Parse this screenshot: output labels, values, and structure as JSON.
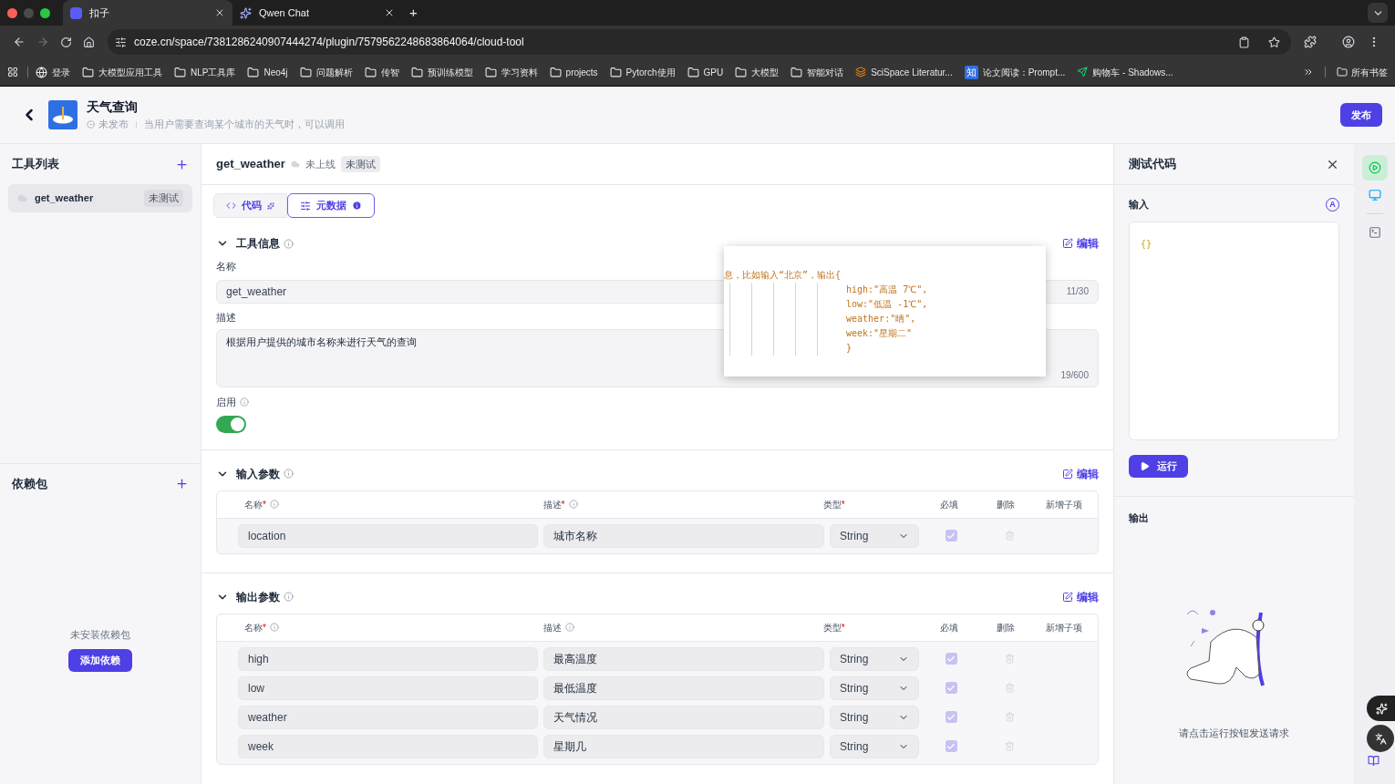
{
  "browser": {
    "tabs": [
      {
        "title": "扣子",
        "selected": true
      },
      {
        "title": "Qwen Chat",
        "selected": false
      }
    ],
    "new_tab": "+",
    "url": "coze.cn/space/7381286240907444274/plugin/7579562248683864064/cloud-tool",
    "bookmarks": [
      {
        "kind": "globe",
        "label": "登录"
      },
      {
        "kind": "folder",
        "label": "大模型应用工具"
      },
      {
        "kind": "folder",
        "label": "NLP工具库"
      },
      {
        "kind": "folder",
        "label": "Neo4j"
      },
      {
        "kind": "folder",
        "label": "问题解析"
      },
      {
        "kind": "folder",
        "label": "传智"
      },
      {
        "kind": "folder",
        "label": "预训练模型"
      },
      {
        "kind": "folder",
        "label": "学习资料"
      },
      {
        "kind": "folder",
        "label": "projects"
      },
      {
        "kind": "folder",
        "label": "Pytorch使用"
      },
      {
        "kind": "folder",
        "label": "GPU"
      },
      {
        "kind": "folder",
        "label": "大模型"
      },
      {
        "kind": "folder",
        "label": "智能对话"
      },
      {
        "kind": "layers",
        "label": "SciSpace Literatur..."
      },
      {
        "kind": "badge",
        "icon_text": "知",
        "label": "论文阅读：Prompt..."
      },
      {
        "kind": "plane",
        "label": "购物车 - Shadows..."
      }
    ],
    "all_bookmarks": "所有书签"
  },
  "header": {
    "title": "天气查询",
    "status": "未发布",
    "description": "当用户需要查询某个城市的天气时，可以调用",
    "publish": "发布"
  },
  "sidebar": {
    "tools_title": "工具列表",
    "tools": [
      {
        "name": "get_weather",
        "badge": "未测试",
        "selected": true
      }
    ],
    "deps_title": "依赖包",
    "deps_empty": "未安装依赖包",
    "add_dep": "添加依赖"
  },
  "tool": {
    "name": "get_weather",
    "status": "未上线",
    "badge": "未测试",
    "modes": [
      {
        "kind": "code",
        "label": "代码",
        "selected": false
      },
      {
        "kind": "meta",
        "label": "元数据",
        "selected": true
      }
    ],
    "info": {
      "title": "工具信息",
      "edit": "编辑",
      "name_label": "名称",
      "name_value": "get_weather",
      "name_count": "11/30",
      "desc_label": "描述",
      "desc_value": "根据用户提供的城市名称来进行天气的查询",
      "desc_count": "19/600",
      "enable_label": "启用",
      "enabled": true
    },
    "popup": [
      "息，比如输入“北京”，输出{",
      "high:\"高温 7℃\",",
      "low:\"低温 -1℃\",",
      "weather:\"晴\",",
      "week:\"星期二\"",
      "}"
    ],
    "inputs": {
      "title": "输入参数",
      "edit": "编辑",
      "columns": [
        {
          "label": "名称",
          "mark": "*",
          "info": true
        },
        {
          "label": "描述",
          "mark": "*",
          "info": true
        },
        {
          "label": "类型",
          "mark": "*",
          "info": false
        },
        {
          "label": "必填",
          "info": false
        },
        {
          "label": "删除",
          "info": false
        },
        {
          "label": "新增子项",
          "info": false
        }
      ],
      "rows": [
        {
          "name": "location",
          "desc": "城市名称",
          "type": "String",
          "required": true
        }
      ]
    },
    "outputs": {
      "title": "输出参数",
      "edit": "编辑",
      "columns": [
        {
          "label": "名称",
          "mark": "*",
          "info": true
        },
        {
          "label": "描述",
          "info": true
        },
        {
          "label": "类型",
          "mark": "*",
          "info": false
        },
        {
          "label": "必填",
          "info": false
        },
        {
          "label": "删除",
          "info": false
        },
        {
          "label": "新增子项",
          "info": false
        }
      ],
      "rows": [
        {
          "name": "high",
          "desc": "最高温度",
          "type": "String",
          "required": true
        },
        {
          "name": "low",
          "desc": "最低温度",
          "type": "String",
          "required": true
        },
        {
          "name": "weather",
          "desc": "天气情况",
          "type": "String",
          "required": true
        },
        {
          "name": "week",
          "desc": "星期几",
          "type": "String",
          "required": true
        }
      ]
    }
  },
  "test": {
    "title": "测试代码",
    "input_label": "输入",
    "auto_fill": "A",
    "input_value": "{}",
    "run": "运行",
    "output_label": "输出",
    "empty": "请点击运行按钮发送请求"
  }
}
